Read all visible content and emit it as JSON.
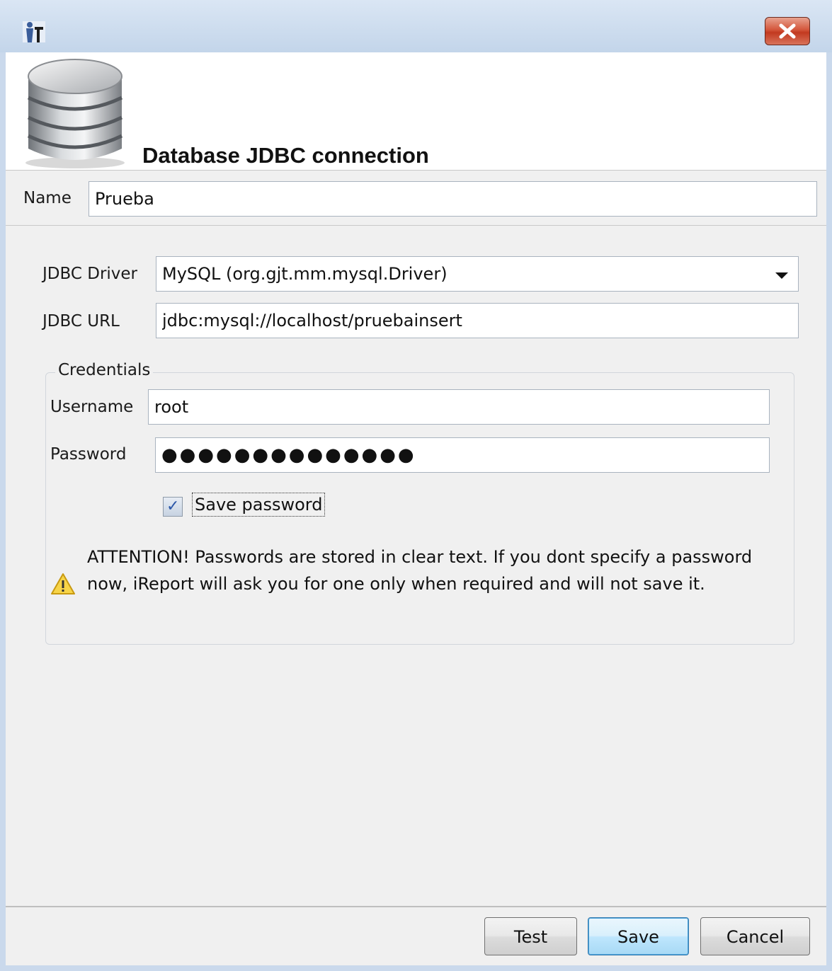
{
  "window": {
    "icon": "ireport-app-icon",
    "close_icon": "close-x-icon"
  },
  "header": {
    "icon": "database-icon",
    "title": "Database JDBC connection"
  },
  "name": {
    "label": "Name",
    "value": "Prueba"
  },
  "driver": {
    "label": "JDBC Driver",
    "selected": "MySQL (org.gjt.mm.mysql.Driver)"
  },
  "url": {
    "label": "JDBC URL",
    "value": "jdbc:mysql://localhost/pruebainsert"
  },
  "credentials": {
    "legend": "Credentials",
    "username_label": "Username",
    "username_value": "root",
    "password_label": "Password",
    "password_mask": "●●●●●●●●●●●●●●",
    "save_password_label": "Save password",
    "save_password_checked": true,
    "warning_icon": "warning-icon",
    "warning_text": "ATTENTION! Passwords are stored in clear text. If you dont specify a password now, iReport will ask you for one only when required and will not save it."
  },
  "buttons": {
    "test": "Test",
    "save": "Save",
    "cancel": "Cancel"
  }
}
